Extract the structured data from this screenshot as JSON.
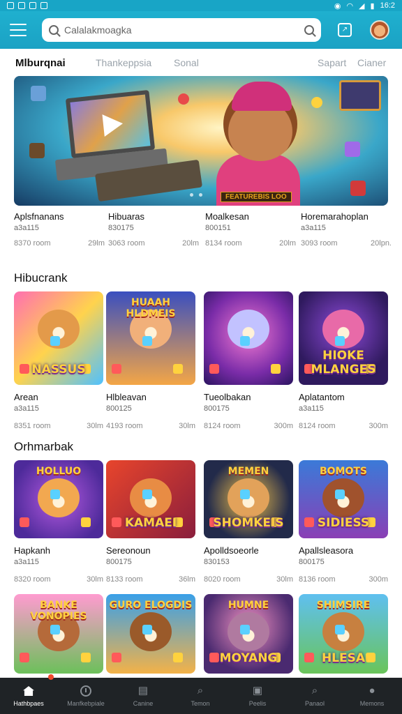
{
  "status": {
    "time": "16:2"
  },
  "search": {
    "value": "Calalakmoagka"
  },
  "tabs": [
    "Mlburqnai",
    "Thankeppsia",
    "Sonal",
    "Sapart",
    "Cianer"
  ],
  "hero": {
    "tag": "FEATUREBIS LOO"
  },
  "featured_meta": [
    {
      "title": "Aplsfnanans",
      "sub": "a3a115",
      "left": "8370 room",
      "right": "29lm"
    },
    {
      "title": "Hibuaras",
      "sub": "830175",
      "left": "3063 room",
      "right": "20lm"
    },
    {
      "title": "Moalkesan",
      "sub": "800151",
      "left": "8134 room",
      "right": "20lm"
    },
    {
      "title": "Horemarahoplan",
      "sub": "a3a115",
      "left": "3093 room",
      "right": "20lpn."
    }
  ],
  "section1": {
    "title": "Hibucrank",
    "cards": [
      {
        "title": "Arean",
        "sub": "a3a115",
        "left": "8351 room",
        "right": "30lm",
        "art_top": "",
        "art_label": "NASSUS",
        "bg": "linear-gradient(135deg,#ff6fb1,#ffd34d,#4fc1ff)",
        "face": "#e39a4a"
      },
      {
        "title": "Hlbleavan",
        "sub": "800125",
        "left": "4193 room",
        "right": "30lm",
        "art_top": "HUAAH HLDMEIS",
        "art_label": "",
        "bg": "linear-gradient(180deg,#3a4fbf,#f4a646)",
        "face": "#f1b07a"
      },
      {
        "title": "Tueolbakan",
        "sub": "800175",
        "left": "8124 room",
        "right": "300m",
        "art_top": "",
        "art_label": "",
        "bg": "radial-gradient(circle at 50% 45%,#f47bd2,#7a2ca8 60%,#2a1460)",
        "face": "#c2c2ff"
      },
      {
        "title": "Aplatantom",
        "sub": "a3a115",
        "left": "8124 room",
        "right": "300m",
        "art_top": "",
        "art_label": "HIOKE MLANGES",
        "bg": "radial-gradient(circle at 50% 40%,#8d4ad8,#2f1a5e 70%)",
        "face": "#e86aa8"
      }
    ]
  },
  "section2": {
    "title": "Orhmarbak",
    "cards": [
      {
        "title": "Hapkanh",
        "sub": "a3a115",
        "left": "8320 room",
        "right": "30lm",
        "art_top": "HOLLUO",
        "art_label": "",
        "bg": "radial-gradient(circle at 50% 50%,#b45ae0,#4d2a9a 80%)",
        "face": "#f2a850"
      },
      {
        "title": "Sereonoun",
        "sub": "800175",
        "left": "8133 room",
        "right": "36lm",
        "art_top": "",
        "art_label": "KAMAEI",
        "bg": "linear-gradient(135deg,#e8452c,#8a1e3c)",
        "face": "#e88c44"
      },
      {
        "title": "Apolldsoeorle",
        "sub": "830153",
        "left": "8020 room",
        "right": "30lm",
        "art_top": "MEMEN",
        "art_label": "SHOMKEIS",
        "bg": "radial-gradient(circle at 50% 50%,#f0c04a,#222a4a 70%)",
        "face": "#e2a25a"
      },
      {
        "title": "Apallsleasora",
        "sub": "800175",
        "left": "8136 room",
        "right": "300m",
        "art_top": "BOMOTS",
        "art_label": "SIDIESS",
        "bg": "linear-gradient(180deg,#3b7ad8,#8a3fb5)",
        "face": "#a0522d"
      }
    ]
  },
  "section3": {
    "cards": [
      {
        "art_top": "BANKE VONOPIES",
        "art_label": "",
        "bg": "linear-gradient(180deg,#ff9bd0,#6cc05a)",
        "face": "#b56a3a"
      },
      {
        "art_top": "GURO ELOGDIS",
        "art_label": "",
        "bg": "linear-gradient(180deg,#3aa0e8,#f3b248)",
        "face": "#9a5a2a"
      },
      {
        "art_top": "HUMNE",
        "art_label": "MOYANG",
        "bg": "radial-gradient(circle at 50% 40%,#f090c0,#4a2a70 70%)",
        "face": "#b07aa0"
      },
      {
        "art_top": "SHIMSIRE",
        "art_label": "HLESA",
        "bg": "linear-gradient(180deg,#5fc0f0,#6ac45a)",
        "face": "#c78040"
      }
    ]
  },
  "nav": [
    {
      "label": "Hathbpaes",
      "icon": "home-icon"
    },
    {
      "label": "Manfkebpiale",
      "icon": "clock-icon"
    },
    {
      "label": "Canine",
      "icon": "stack-icon"
    },
    {
      "label": "Temon",
      "icon": "search-icon"
    },
    {
      "label": "Peelis",
      "icon": "bag-icon"
    },
    {
      "label": "Panaol",
      "icon": "search-icon"
    },
    {
      "label": "Memons",
      "icon": "person-icon"
    }
  ]
}
